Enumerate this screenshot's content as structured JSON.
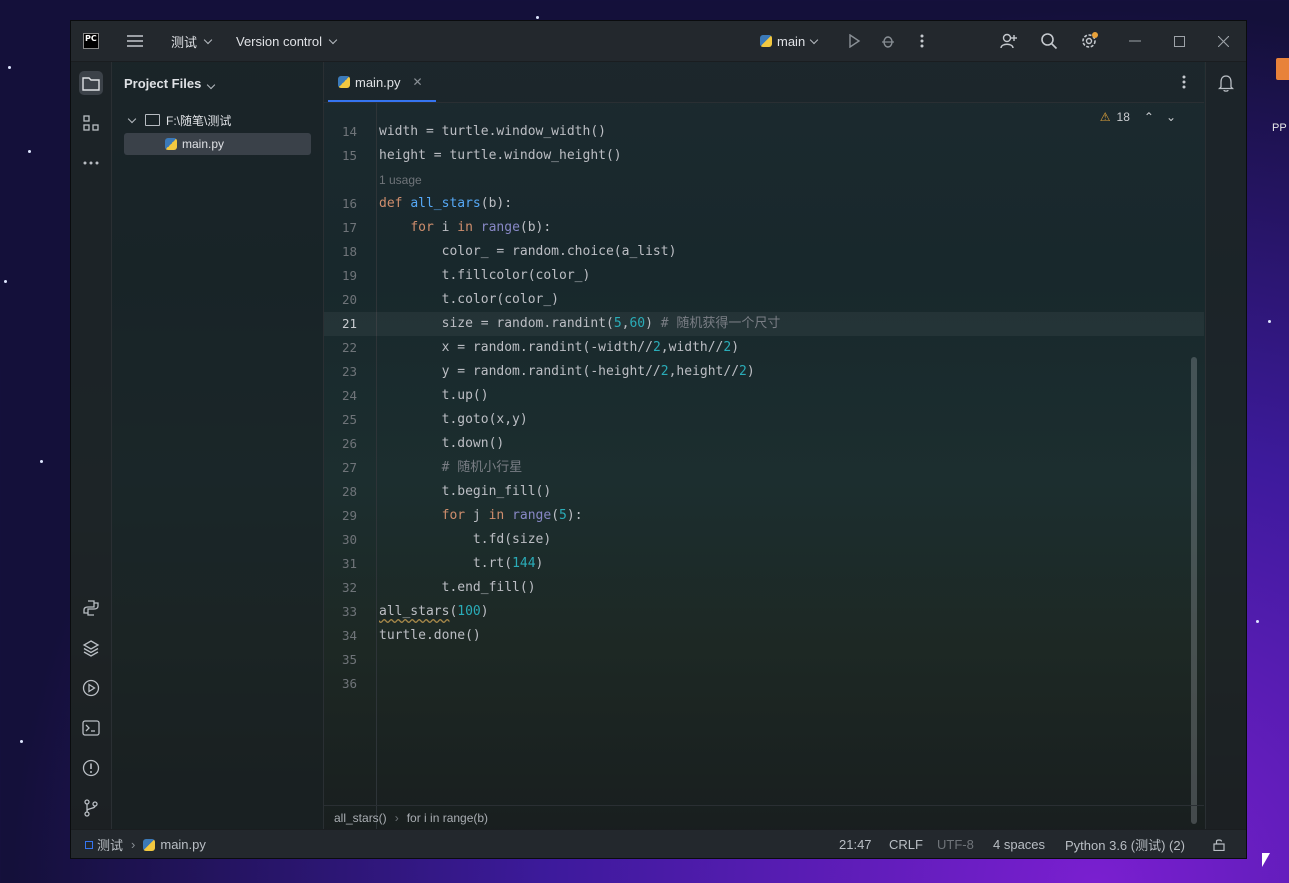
{
  "titlebar": {
    "project_name": "测试",
    "vcs_label": "Version control",
    "run_config": "main",
    "app_logo": "PC"
  },
  "project_panel": {
    "title": "Project Files",
    "root_folder": "F:\\随笔\\测试",
    "file": "main.py"
  },
  "editor": {
    "tab_label": "main.py",
    "usage_hint": "1 usage",
    "warning_count": "18",
    "lines": [
      {
        "n": "14",
        "text": "width = turtle.window_width()"
      },
      {
        "n": "15",
        "text": "height = turtle.window_height()"
      },
      {
        "n": "16",
        "text": "def all_stars(b):"
      },
      {
        "n": "17",
        "text": "    for i in range(b):"
      },
      {
        "n": "18",
        "text": "        color_ = random.choice(a_list)"
      },
      {
        "n": "19",
        "text": "        t.fillcolor(color_)"
      },
      {
        "n": "20",
        "text": "        t.color(color_)"
      },
      {
        "n": "21",
        "text": "        size = random.randint(5,60) # 随机获得一个尺寸"
      },
      {
        "n": "22",
        "text": "        x = random.randint(-width//2,width//2)"
      },
      {
        "n": "23",
        "text": "        y = random.randint(-height//2,height//2)"
      },
      {
        "n": "24",
        "text": "        t.up()"
      },
      {
        "n": "25",
        "text": "        t.goto(x,y)"
      },
      {
        "n": "26",
        "text": "        t.down()"
      },
      {
        "n": "27",
        "text": "        # 随机小行星"
      },
      {
        "n": "28",
        "text": "        t.begin_fill()"
      },
      {
        "n": "29",
        "text": "        for j in range(5):"
      },
      {
        "n": "30",
        "text": "            t.fd(size)"
      },
      {
        "n": "31",
        "text": "            t.rt(144)"
      },
      {
        "n": "32",
        "text": "        t.end_fill()"
      },
      {
        "n": "33",
        "text": "all_stars(100)"
      },
      {
        "n": "34",
        "text": "turtle.done()"
      },
      {
        "n": "35",
        "text": ""
      },
      {
        "n": "36",
        "text": ""
      }
    ],
    "current_line": "21",
    "breadcrumb": [
      "all_stars()",
      "for i in range(b)"
    ]
  },
  "statusbar": {
    "project": "测试",
    "file": "main.py",
    "position": "21:47",
    "line_sep": "CRLF",
    "encoding": "UTF-8",
    "indent": "4 spaces",
    "interpreter": "Python 3.6 (测试) (2)"
  },
  "desktop": {
    "icon_label": "PP"
  },
  "colors": {
    "keyword": "#cf8e6d",
    "function": "#56a8f5",
    "number": "#2aacb8",
    "comment": "#7a7e85",
    "tab_accent": "#3574f0"
  }
}
